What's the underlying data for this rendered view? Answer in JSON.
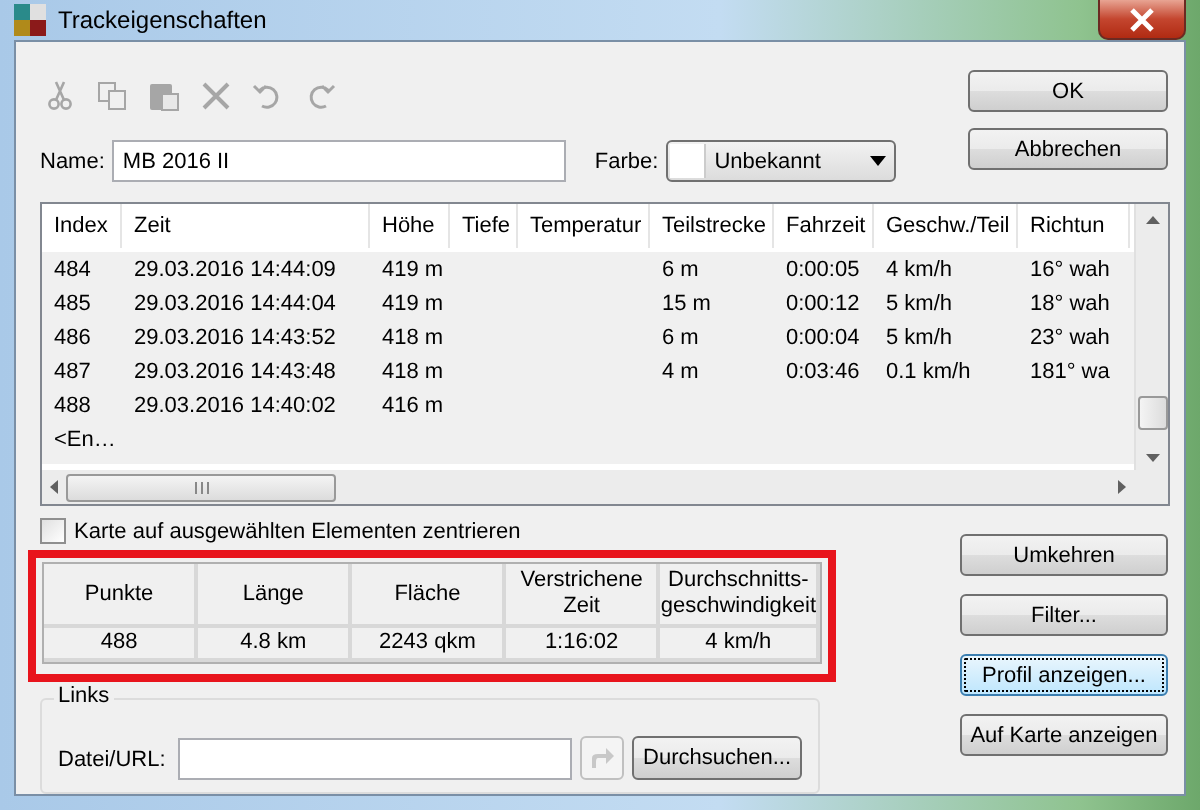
{
  "window": {
    "title": "Trackeigenschaften"
  },
  "toolbar": {
    "kind": "icons",
    "disabled": true
  },
  "name_field": {
    "label": "Name:",
    "value": "MB 2016 II"
  },
  "color_field": {
    "label": "Farbe:",
    "value": "Unbekannt"
  },
  "dialog_buttons": [
    {
      "label": "OK"
    },
    {
      "label": "Abbrechen"
    }
  ],
  "table": {
    "columns": [
      "Index",
      "Zeit",
      "Höhe",
      "Tiefe",
      "Temperatur",
      "Teilstrecke",
      "Fahrzeit",
      "Geschw./Teil",
      "Richtun"
    ],
    "rows": [
      [
        "484",
        "29.03.2016 14:44:09",
        "419 m",
        "",
        "",
        "6 m",
        "0:00:05",
        "4 km/h",
        "16° wah"
      ],
      [
        "485",
        "29.03.2016 14:44:04",
        "419 m",
        "",
        "",
        "15 m",
        "0:00:12",
        "5 km/h",
        "18° wah"
      ],
      [
        "486",
        "29.03.2016 14:43:52",
        "418 m",
        "",
        "",
        "6 m",
        "0:00:04",
        "5 km/h",
        "23° wah"
      ],
      [
        "487",
        "29.03.2016 14:43:48",
        "418 m",
        "",
        "",
        "4 m",
        "0:03:46",
        "0.1 km/h",
        "181° wa"
      ],
      [
        "488",
        "29.03.2016 14:40:02",
        "416 m",
        "",
        "",
        "",
        "",
        "",
        ""
      ],
      [
        "<En…",
        "",
        "",
        "",
        "",
        "",
        "",
        "",
        ""
      ]
    ]
  },
  "center_checkbox": {
    "label": "Karte auf ausgewählten Elementen zentrieren",
    "checked": false
  },
  "stats": {
    "highlighted": true,
    "columns": [
      "Punkte",
      "Länge",
      "Fläche",
      "Verstrichene Zeit",
      "Durchschnitts-geschwindigkeit"
    ],
    "values": [
      "488",
      "4.8 km",
      "2243 qkm",
      "1:16:02",
      "4 km/h"
    ]
  },
  "links": {
    "title": "Links",
    "label": "Datei/URL:",
    "browse": "Durchsuchen..."
  },
  "side_buttons": [
    {
      "label": "Umkehren",
      "focused": false
    },
    {
      "label": "Filter...",
      "focused": false
    },
    {
      "label": "Profil anzeigen...",
      "focused": true
    },
    {
      "label": "Auf Karte anzeigen",
      "focused": false
    }
  ]
}
